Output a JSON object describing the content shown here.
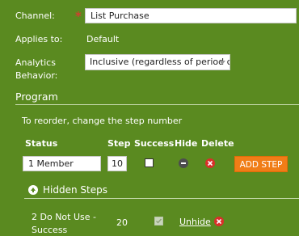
{
  "form": {
    "channel_label": "Channel:",
    "channel_value": "List Purchase",
    "applies_label": "Applies to:",
    "applies_value": "Default",
    "analytics_label_line1": "Analytics",
    "analytics_label_line2": "Behavior:",
    "analytics_value": "Inclusive (regardless of period cost)"
  },
  "program": {
    "title": "Program",
    "reorder_hint": "To reorder, change the step number",
    "columns": {
      "status": "Status",
      "step": "Step",
      "success": "Success",
      "hide": "Hide",
      "delete": "Delete"
    },
    "row": {
      "status": "1 Member",
      "step": "10",
      "success_checked": false
    },
    "add_step_label": "ADD STEP",
    "hidden_steps_label": "Hidden Steps",
    "hidden_row": {
      "status_line1": "2 Do Not Use -",
      "status_line2": "Success",
      "step": "20",
      "success_checked": true,
      "unhide_label": "Unhide"
    }
  },
  "colors": {
    "background": "#5a8a20",
    "required_star": "#d04030",
    "add_step_button": "#f07d17",
    "delete_icon": "#d9302a"
  }
}
